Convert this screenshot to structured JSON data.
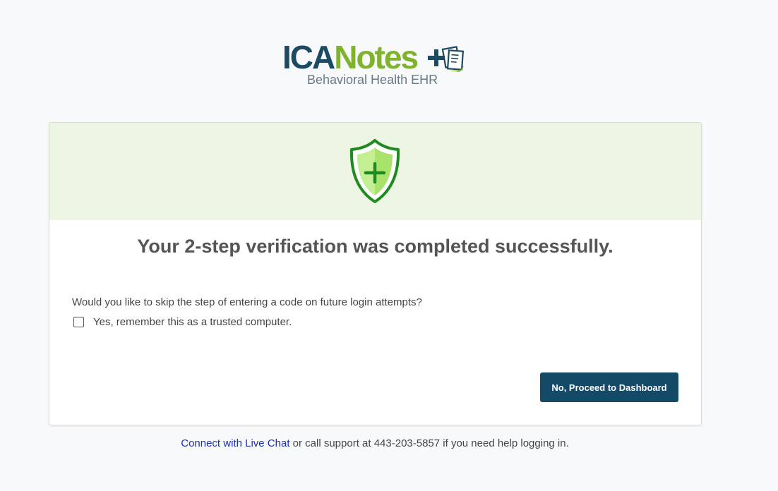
{
  "logo": {
    "ica": "ICA",
    "notes": "Notes",
    "tagline": "Behavioral Health EHR",
    "colors": {
      "navy": "#1c4a63",
      "green": "#7fb32e"
    }
  },
  "hero": {
    "icon": "shield-plus-icon",
    "background": "#ecf5e1"
  },
  "card": {
    "title": "Your 2-step verification was completed successfully.",
    "question": "Would you like to skip the step of entering a code on future login attempts?",
    "checkbox_label": "Yes, remember this as a trusted computer.",
    "checkbox_checked": false,
    "proceed_button": "No, Proceed to Dashboard"
  },
  "footer": {
    "chat_link": "Connect with Live Chat",
    "support_text": " or call support at 443-203-5857 if you need help logging in."
  },
  "colors": {
    "button": "#154a66",
    "link": "#1a2fb4",
    "shield_green": "#1f8a1f"
  }
}
